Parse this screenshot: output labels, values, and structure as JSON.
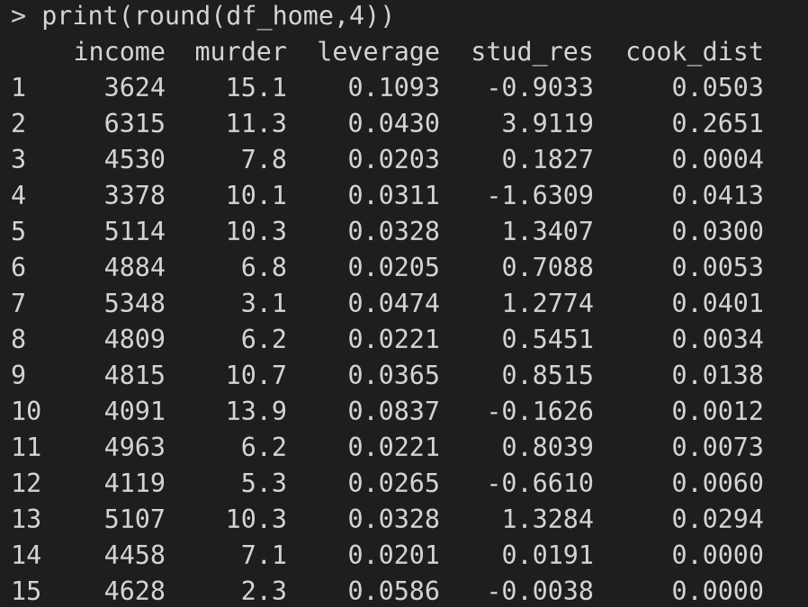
{
  "console": {
    "prompt_symbol": ">",
    "command": "print(round(df_home,4))"
  },
  "table": {
    "headers": {
      "index": "",
      "income": "income",
      "murder": "murder",
      "leverage": "leverage",
      "stud_res": "stud_res",
      "cook_dist": "cook_dist"
    },
    "rows": [
      {
        "index": "1",
        "income": "3624",
        "murder": "15.1",
        "leverage": "0.1093",
        "stud_res": "-0.9033",
        "cook_dist": "0.0503"
      },
      {
        "index": "2",
        "income": "6315",
        "murder": "11.3",
        "leverage": "0.0430",
        "stud_res": "3.9119",
        "cook_dist": "0.2651"
      },
      {
        "index": "3",
        "income": "4530",
        "murder": "7.8",
        "leverage": "0.0203",
        "stud_res": "0.1827",
        "cook_dist": "0.0004"
      },
      {
        "index": "4",
        "income": "3378",
        "murder": "10.1",
        "leverage": "0.0311",
        "stud_res": "-1.6309",
        "cook_dist": "0.0413"
      },
      {
        "index": "5",
        "income": "5114",
        "murder": "10.3",
        "leverage": "0.0328",
        "stud_res": "1.3407",
        "cook_dist": "0.0300"
      },
      {
        "index": "6",
        "income": "4884",
        "murder": "6.8",
        "leverage": "0.0205",
        "stud_res": "0.7088",
        "cook_dist": "0.0053"
      },
      {
        "index": "7",
        "income": "5348",
        "murder": "3.1",
        "leverage": "0.0474",
        "stud_res": "1.2774",
        "cook_dist": "0.0401"
      },
      {
        "index": "8",
        "income": "4809",
        "murder": "6.2",
        "leverage": "0.0221",
        "stud_res": "0.5451",
        "cook_dist": "0.0034"
      },
      {
        "index": "9",
        "income": "4815",
        "murder": "10.7",
        "leverage": "0.0365",
        "stud_res": "0.8515",
        "cook_dist": "0.0138"
      },
      {
        "index": "10",
        "income": "4091",
        "murder": "13.9",
        "leverage": "0.0837",
        "stud_res": "-0.1626",
        "cook_dist": "0.0012"
      },
      {
        "index": "11",
        "income": "4963",
        "murder": "6.2",
        "leverage": "0.0221",
        "stud_res": "0.8039",
        "cook_dist": "0.0073"
      },
      {
        "index": "12",
        "income": "4119",
        "murder": "5.3",
        "leverage": "0.0265",
        "stud_res": "-0.6610",
        "cook_dist": "0.0060"
      },
      {
        "index": "13",
        "income": "5107",
        "murder": "10.3",
        "leverage": "0.0328",
        "stud_res": "1.3284",
        "cook_dist": "0.0294"
      },
      {
        "index": "14",
        "income": "4458",
        "murder": "7.1",
        "leverage": "0.0201",
        "stud_res": "0.0191",
        "cook_dist": "0.0000"
      },
      {
        "index": "15",
        "income": "4628",
        "murder": "2.3",
        "leverage": "0.0586",
        "stud_res": "-0.0038",
        "cook_dist": "0.0000"
      }
    ]
  }
}
